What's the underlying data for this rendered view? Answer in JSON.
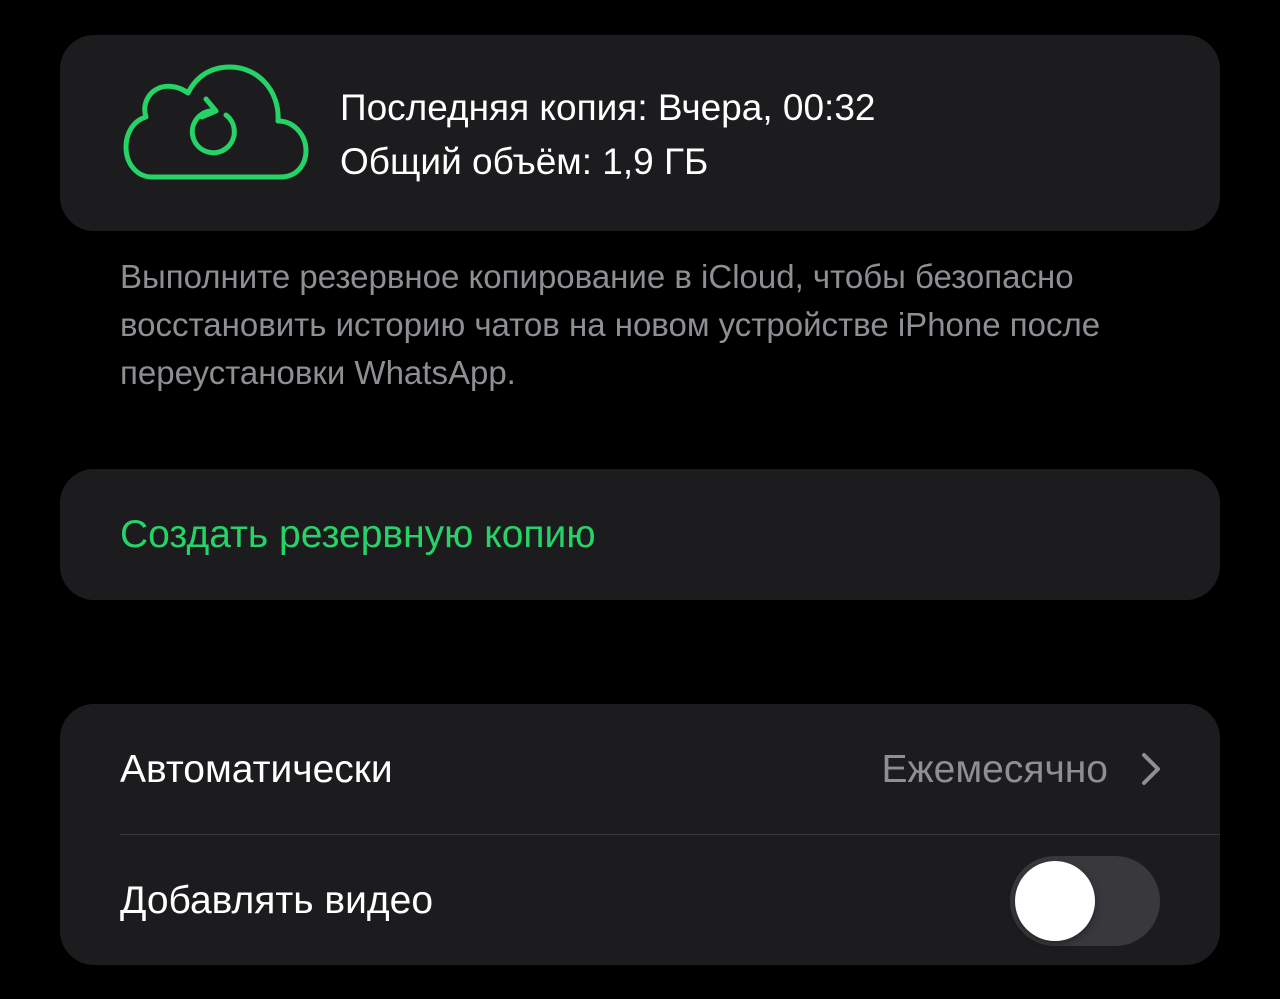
{
  "colors": {
    "background": "#000000",
    "card": "#1c1c1e",
    "accent_green": "#25d366",
    "secondary_text": "#8e8e93",
    "toggle_off": "#39393d"
  },
  "backup": {
    "icon": "cloud-refresh-icon",
    "last_backup": "Последняя копия: Вчера, 00:32",
    "total_size": "Общий объём: 1,9 ГБ"
  },
  "description": "Выполните резервное копирование в iCloud, чтобы безопасно восстановить историю чатов на новом устройстве iPhone после переустановки WhatsApp.",
  "action": {
    "create_backup_label": "Создать резервную копию"
  },
  "settings": {
    "auto_backup": {
      "label": "Автоматически",
      "value": "Ежемесячно",
      "icon": "chevron-right-icon"
    },
    "include_videos": {
      "label": "Добавлять видео",
      "enabled": false
    }
  },
  "footer_partial": ""
}
